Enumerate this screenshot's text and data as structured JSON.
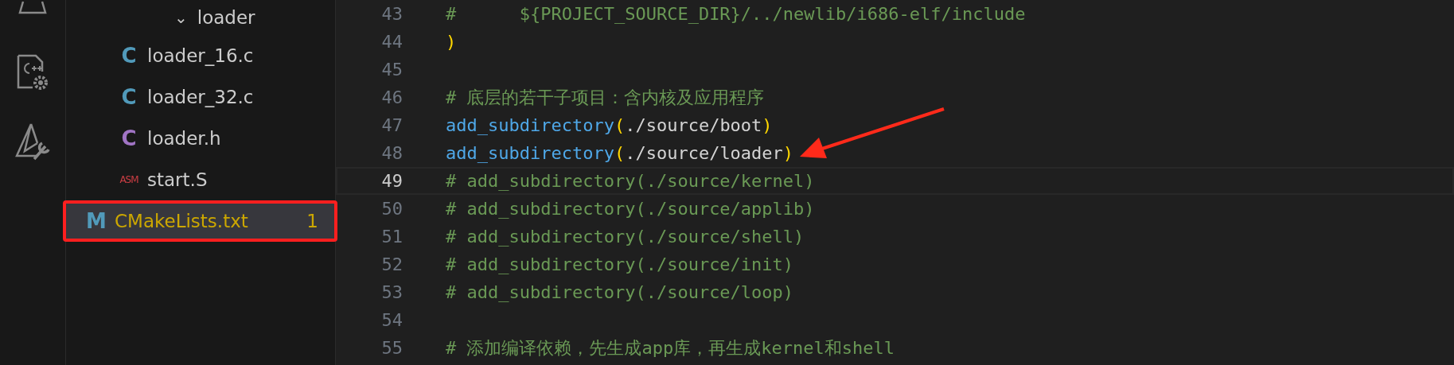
{
  "explorer": {
    "folder": {
      "name": "loader",
      "expanded": true,
      "chevron": "⌄"
    },
    "files": [
      {
        "icon": "C",
        "color": "#519aba",
        "name": "loader_16.c",
        "selected": false,
        "warning": false,
        "annotated": false
      },
      {
        "icon": "C",
        "color": "#519aba",
        "name": "loader_32.c",
        "selected": false,
        "warning": false,
        "annotated": false
      },
      {
        "icon": "C",
        "color": "#a074c4",
        "name": "loader.h",
        "selected": false,
        "warning": false,
        "annotated": false
      },
      {
        "icon": "ASM",
        "color": "#cc3e44",
        "name": "start.S",
        "selected": false,
        "warning": false,
        "annotated": false
      },
      {
        "icon": "M",
        "color": "#519aba",
        "name": "CMakeLists.txt",
        "selected": true,
        "warning": true,
        "badge": "1",
        "annotated": true
      }
    ]
  },
  "editor": {
    "lines": [
      {
        "number": "43",
        "current": false,
        "arrow": false,
        "tokens": [
          {
            "kind": "comment",
            "text": "#      ${PROJECT_SOURCE_DIR}/../newlib/i686-elf/include"
          }
        ]
      },
      {
        "number": "44",
        "current": false,
        "arrow": false,
        "tokens": [
          {
            "kind": "paren",
            "text": ")"
          }
        ]
      },
      {
        "number": "45",
        "current": false,
        "arrow": false
      },
      {
        "number": "46",
        "current": false,
        "arrow": false,
        "tokens": [
          {
            "kind": "comment",
            "text": "# 底层的若干子项目：含内核及应用程序"
          }
        ]
      },
      {
        "number": "47",
        "current": false,
        "arrow": false,
        "tokens": [
          {
            "kind": "fn",
            "text": "add_subdirectory"
          },
          {
            "kind": "paren",
            "text": "("
          },
          {
            "kind": "text",
            "text": "./source/boot"
          },
          {
            "kind": "paren",
            "text": ")"
          }
        ]
      },
      {
        "number": "48",
        "current": false,
        "arrow": true,
        "tokens": [
          {
            "kind": "fn",
            "text": "add_subdirectory"
          },
          {
            "kind": "paren",
            "text": "("
          },
          {
            "kind": "text",
            "text": "./source/loader"
          },
          {
            "kind": "paren",
            "text": ")"
          }
        ]
      },
      {
        "number": "49",
        "current": true,
        "arrow": false,
        "tokens": [
          {
            "kind": "comment",
            "text": "# add_subdirectory(./source/kernel)"
          }
        ]
      },
      {
        "number": "50",
        "current": false,
        "arrow": false,
        "tokens": [
          {
            "kind": "comment",
            "text": "# add_subdirectory(./source/applib)"
          }
        ]
      },
      {
        "number": "51",
        "current": false,
        "arrow": false,
        "tokens": [
          {
            "kind": "comment",
            "text": "# add_subdirectory(./source/shell)"
          }
        ]
      },
      {
        "number": "52",
        "current": false,
        "arrow": false,
        "tokens": [
          {
            "kind": "comment",
            "text": "# add_subdirectory(./source/init)"
          }
        ]
      },
      {
        "number": "53",
        "current": false,
        "arrow": false,
        "tokens": [
          {
            "kind": "comment",
            "text": "# add_subdirectory(./source/loop)"
          }
        ]
      },
      {
        "number": "54",
        "current": false,
        "arrow": false
      },
      {
        "number": "55",
        "current": false,
        "arrow": false,
        "tokens": [
          {
            "kind": "comment",
            "text": "# 添加编译依赖，先生成app库，再生成kernel和shell"
          }
        ]
      }
    ]
  }
}
